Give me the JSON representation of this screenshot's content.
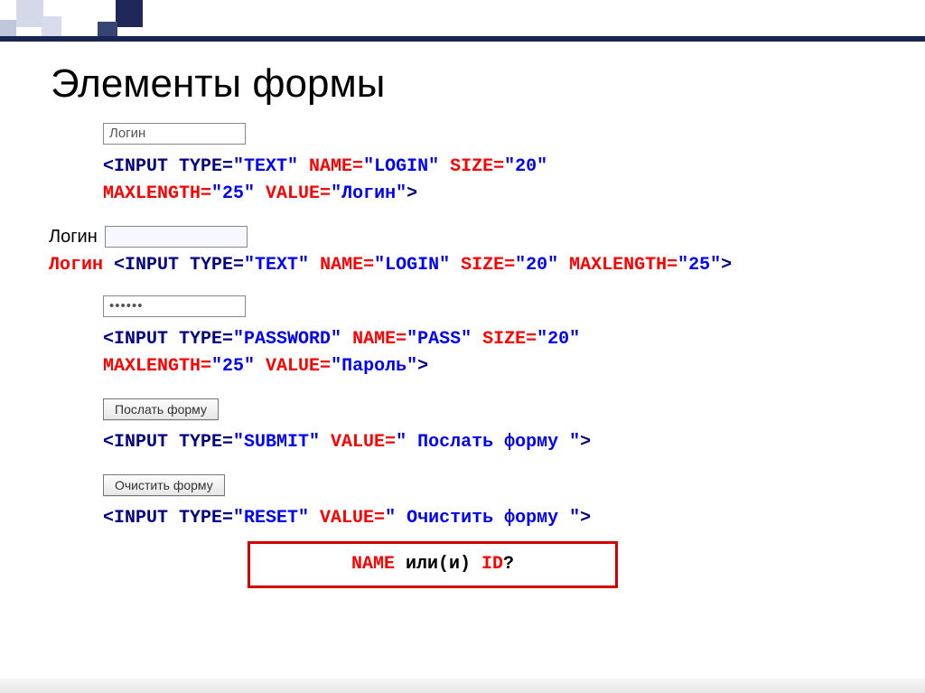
{
  "title": "Элементы формы",
  "ex1": {
    "field_value": "Логин",
    "code_line1": {
      "a": "<INPUT TYPE=",
      "b": "\"TEXT\"",
      "c": " NAME=",
      "d": "\"LOGIN\"",
      "e": " SIZE=",
      "f": "\"20\""
    },
    "code_line2": {
      "a": "MAXLENGTH=",
      "b": "\"25\"",
      "c": " VALUE=",
      "d": "\"Логин\"",
      "e": ">"
    }
  },
  "ex2": {
    "label": "Логин",
    "code_label": "Логин ",
    "code": {
      "a": "<INPUT TYPE=",
      "b": "\"TEXT\"",
      "c": " NAME=",
      "d": "\"LOGIN\"",
      "e": " SIZE=",
      "f": "\"20\"",
      "g": " MAXLENGTH=",
      "h": "\"25\"",
      "i": ">"
    }
  },
  "ex3": {
    "field_value": "••••••",
    "code_line1": {
      "a": "<INPUT TYPE=",
      "b": "\"PASSWORD\"",
      "c": " NAME=",
      "d": "\"PASS\"",
      "e": " SIZE=",
      "f": "\"20\""
    },
    "code_line2": {
      "a": "MAXLENGTH=",
      "b": "\"25\"",
      "c": " VALUE=",
      "d": "\"Пароль\"",
      "e": ">"
    }
  },
  "ex4": {
    "btn": "Послать форму",
    "code": {
      "a": "<INPUT TYPE=",
      "b": "\"SUBMIT\"",
      "c": " VALUE=",
      "d": "\" Послать форму \"",
      "e": ">"
    }
  },
  "ex5": {
    "btn": "Очистить форму",
    "code": {
      "a": "<INPUT TYPE=",
      "b": "\"RESET\"",
      "c": " VALUE=",
      "d": "\" Очистить форму \"",
      "e": ">"
    }
  },
  "question": {
    "a": "NAME",
    "b": " или(и) ",
    "c": "ID",
    "d": "?"
  }
}
